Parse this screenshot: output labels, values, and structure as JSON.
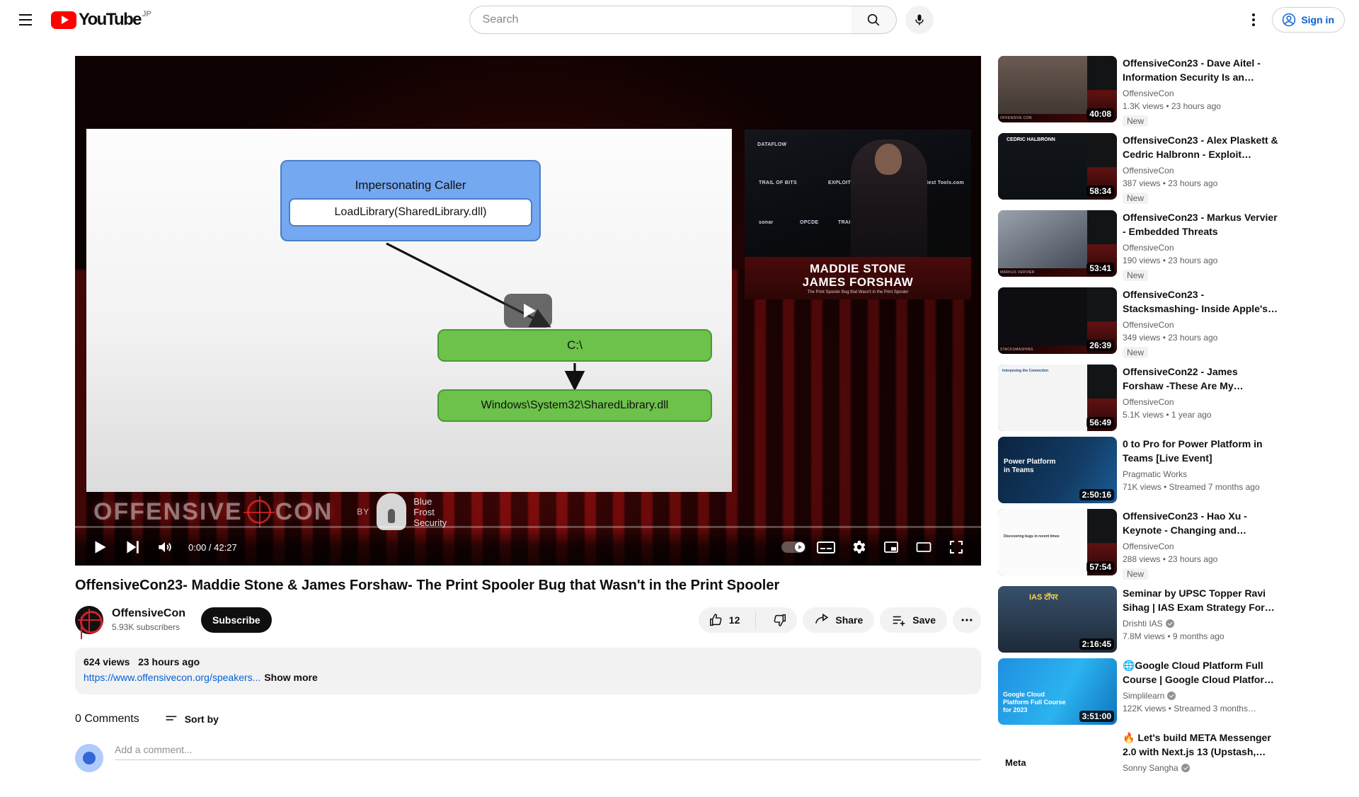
{
  "masthead": {
    "menu_icon": "hamburger-icon",
    "logo_text": "YouTube",
    "country_code": "JP",
    "search_placeholder": "Search",
    "search_value": "",
    "search_icon": "search-icon",
    "mic_icon": "microphone-icon",
    "settings_icon": "more-vertical-icon",
    "signin_label": "Sign in",
    "signin_icon": "account-circle-icon"
  },
  "player": {
    "current_time": "0:00",
    "total_time": "42:27",
    "time_display": "0:00 / 42:27",
    "progress_percent": 0,
    "play_icon": "play-icon",
    "next_icon": "next-track-icon",
    "volume_icon": "volume-icon",
    "autoplay_label": "Autoplay",
    "cc_label": "CC",
    "settings_icon": "gear-icon",
    "miniplayer_icon": "miniplayer-icon",
    "theater_icon": "theater-mode-icon",
    "fullscreen_icon": "fullscreen-icon",
    "big_play_icon": "large-play-button",
    "slide": {
      "caller_title": "Impersonating Caller",
      "caller_call": "LoadLibrary(SharedLibrary.dll)",
      "path_root": "C:\\",
      "path_full": "Windows\\System32\\SharedLibrary.dll"
    },
    "webcam": {
      "speaker_line1": "MADDIE STONE",
      "speaker_line2": "JAMES FORSHAW",
      "talk_subtitle": "The Print Spooler Bug that Wasn't in the Print Spooler",
      "sponsors": [
        "DATAFLOW",
        "TRAIL OF BITS",
        "EXPLOIT LABS",
        "Pentest Tools.com",
        "sonar",
        "OPCDE",
        "TRAIL OF BITS"
      ]
    },
    "branding": {
      "conference": "OFFENSIVE",
      "conference2": "CON",
      "by_label": "BY",
      "sponsor_line1": "Blue",
      "sponsor_line2": "Frost",
      "sponsor_line3": "Security"
    }
  },
  "video": {
    "title": "OffensiveCon23- Maddie Stone & James Forshaw- The Print Spooler Bug that Wasn't in the Print Spooler",
    "channel_name": "OffensiveCon",
    "channel_subs": "5.93K subscribers",
    "subscribe_label": "Subscribe",
    "like_count": "12",
    "like_icon": "thumbs-up-icon",
    "dislike_icon": "thumbs-down-icon",
    "share_label": "Share",
    "share_icon": "share-icon",
    "save_label": "Save",
    "save_icon": "save-to-playlist-icon",
    "more_icon": "more-horizontal-icon",
    "views": "624 views",
    "published": "23 hours ago",
    "description_link": "https://www.offensivecon.org/speakers...",
    "show_more_label": "Show more"
  },
  "comments": {
    "count_label": "0 Comments",
    "sort_label": "Sort by",
    "sort_icon": "sort-icon",
    "input_placeholder": "Add a comment..."
  },
  "recommendations": [
    {
      "title": "OffensiveCon23 - Dave Aitel - Information Security Is an…",
      "channel": "OffensiveCon",
      "verified": false,
      "stats": "1.3K views  • 23 hours ago",
      "duration": "40:08",
      "badge": "New",
      "thumb_style": "oc-award",
      "thumb_caption": "OFFENSIVE CON"
    },
    {
      "title": "OffensiveCon23 - Alex Plaskett & Cedric Halbronn - Exploit…",
      "channel": "OffensiveCon",
      "verified": false,
      "stats": "387 views  • 23 hours ago",
      "duration": "58:34",
      "badge": "New",
      "thumb_style": "oc-slide",
      "thumb_caption": "CEDRIC HALBRONN"
    },
    {
      "title": "OffensiveCon23 - Markus Vervier - Embedded Threats",
      "channel": "OffensiveCon",
      "verified": false,
      "stats": "190 views  • 23 hours ago",
      "duration": "53:41",
      "badge": "New",
      "thumb_style": "oc-phone",
      "thumb_caption": "MARKUS VERVIER"
    },
    {
      "title": "OffensiveCon23 - Stacksmashing- Inside Apple's…",
      "channel": "OffensiveCon",
      "verified": false,
      "stats": "349 views  • 23 hours ago",
      "duration": "26:39",
      "badge": "New",
      "thumb_style": "oc-walrus",
      "thumb_caption": "STACKSMASHING"
    },
    {
      "title": "OffensiveCon22 - James Forshaw -These Are My…",
      "channel": "OffensiveCon",
      "verified": false,
      "stats": "5.1K views  • 1 year ago",
      "duration": "56:49",
      "badge": "",
      "thumb_style": "oc-diagram",
      "thumb_caption": "Interposing the Connection"
    },
    {
      "title": "0 to Pro for Power Platform in Teams [Live Event]",
      "channel": "Pragmatic Works",
      "verified": false,
      "stats": "71K views  • Streamed 7 months ago",
      "duration": "2:50:16",
      "badge": "",
      "thumb_style": "power-platform",
      "thumb_caption": "Power Platform in Teams"
    },
    {
      "title": "OffensiveCon23 - Hao Xu - Keynote - Changing and…",
      "channel": "OffensiveCon",
      "verified": false,
      "stats": "288 views  • 23 hours ago",
      "duration": "57:54",
      "badge": "New",
      "thumb_style": "oc-whiteslide",
      "thumb_caption": "Discovering bugs in recent times"
    },
    {
      "title": "Seminar by UPSC Topper Ravi Sihag | IAS Exam Strategy For…",
      "channel": "Drishti IAS",
      "verified": true,
      "stats": "7.8M views  • 9 months ago",
      "duration": "2:16:45",
      "badge": "",
      "thumb_style": "ias",
      "thumb_caption": "IAS टॉपर"
    },
    {
      "title": "🌐Google Cloud Platform Full Course | Google Cloud Platfor…",
      "channel": "Simplilearn",
      "verified": true,
      "stats": "122K views  • Streamed 3 months…",
      "duration": "3:51:00",
      "badge": "",
      "thumb_style": "gcp",
      "thumb_caption": "Google Cloud Platform Full Course for 2023"
    },
    {
      "title": "🔥 Let's build META Messenger 2.0 with Next.js 13 (Upstash,…",
      "channel": "Sonny Sangha",
      "verified": true,
      "stats": "",
      "duration": "",
      "badge": "",
      "thumb_style": "meta",
      "thumb_caption": "Meta"
    }
  ]
}
